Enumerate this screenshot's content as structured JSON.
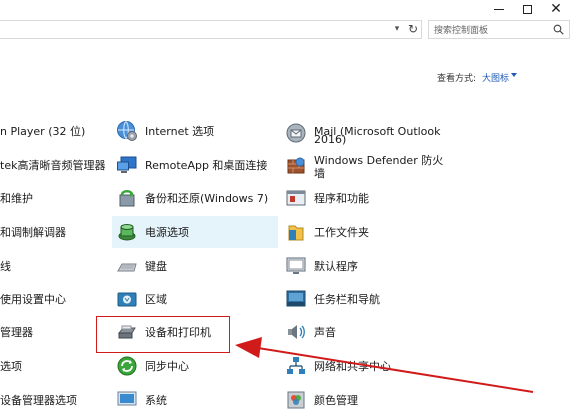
{
  "window": {
    "minimize": "—",
    "maximize": "☐",
    "close": "✕"
  },
  "address": {
    "search_placeholder": "搜索控制面板"
  },
  "view": {
    "label": "查看方式:",
    "value": "大图标"
  },
  "items": {
    "col1": [
      "n Player (32 位)",
      "tek高清晰音频管理器",
      "和维护",
      "和调制解调器",
      "线",
      "使用设置中心",
      "管理器",
      "选项",
      "设备管理器选项"
    ],
    "col2": [
      "Internet 选项",
      "RemoteApp 和桌面连接",
      "备份和还原(Windows 7)",
      "电源选项",
      "键盘",
      "区域",
      "设备和打印机",
      "同步中心",
      "系统"
    ],
    "col3": [
      "Mail (Microsoft Outlook",
      "2016)",
      "Windows Defender 防火",
      "墙",
      "程序和功能",
      "工作文件夹",
      "默认程序",
      "任务栏和导航",
      "声音",
      "网络和共享中心",
      "颜色管理"
    ]
  },
  "colors": {
    "accent": "#1e5bb8",
    "highlight": "#e5f3fb",
    "annotation": "#d11b1b"
  },
  "icons": {
    "col2": [
      "globe-gear-icon",
      "remote-desktop-icon",
      "backup-restore-icon",
      "power-options-icon",
      "keyboard-icon",
      "region-icon",
      "printer-icon",
      "sync-center-icon",
      "system-icon"
    ],
    "col3": [
      "mail-icon",
      "firewall-icon",
      "programs-icon",
      "work-folders-icon",
      "default-programs-icon",
      "taskbar-icon",
      "sound-icon",
      "network-icon",
      "color-management-icon"
    ]
  }
}
